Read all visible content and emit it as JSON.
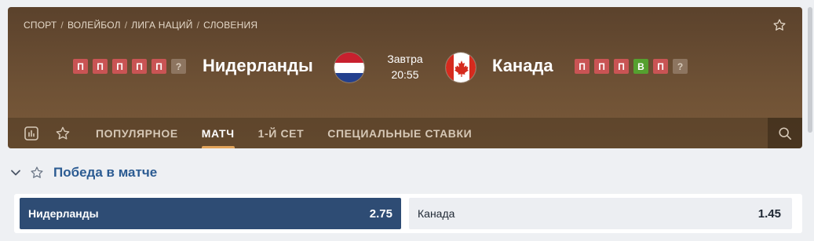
{
  "breadcrumb": [
    "СПОРТ",
    "ВОЛЕЙБОЛ",
    "ЛИГА НАЦИЙ",
    "СЛОВЕНИЯ"
  ],
  "breadcrumb_separator": "/",
  "home": {
    "name": "Нидерланды",
    "form": [
      "П",
      "П",
      "П",
      "П",
      "П",
      "?"
    ],
    "flag": "netherlands-flag"
  },
  "away": {
    "name": "Канада",
    "form": [
      "П",
      "П",
      "П",
      "В",
      "П",
      "?"
    ],
    "flag": "canada-flag"
  },
  "match_time": {
    "day": "Завтра",
    "time": "20:55"
  },
  "tabs": [
    {
      "label": "ПОПУЛЯРНОЕ",
      "active": false
    },
    {
      "label": "МАТЧ",
      "active": true
    },
    {
      "label": "1-Й СЕТ",
      "active": false
    },
    {
      "label": "СПЕЦИАЛЬНЫЕ СТАВКИ",
      "active": false
    }
  ],
  "market": {
    "title": "Победа в матче",
    "outcomes": [
      {
        "label": "Нидерланды",
        "odds": "2.75",
        "selected": true
      },
      {
        "label": "Канада",
        "odds": "1.45",
        "selected": false
      }
    ]
  },
  "colors": {
    "loss": "#c95454",
    "win": "#55a02f",
    "unknown": "#8d7560",
    "accent_tab": "#e2a45a",
    "market_title": "#2b5b92",
    "selected_odd": "#2e4c74"
  },
  "icons": {
    "favorite": "star-icon",
    "stats": "stats-icon",
    "search": "search-icon",
    "collapse": "chevron-down-icon"
  }
}
